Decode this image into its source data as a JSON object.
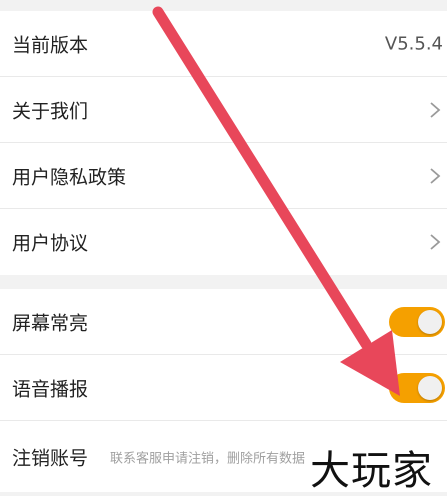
{
  "about": {
    "version_label": "当前版本",
    "version_value": "V5.5.4",
    "about_us": "关于我们",
    "privacy_policy": "用户隐私政策",
    "user_agreement": "用户协议"
  },
  "settings": {
    "screen_on_label": "屏幕常亮",
    "screen_on_enabled": true,
    "voice_broadcast_label": "语音播报",
    "voice_broadcast_enabled": true,
    "cancel_account_label": "注销账号",
    "cancel_account_hint": "联系客服申请注销，删除所有数据"
  },
  "colors": {
    "toggle_on": "#f5a000",
    "annotation_arrow": "#e8475a"
  },
  "icons": {
    "chevron": "chevron-right-icon"
  },
  "watermark": "大玩家"
}
